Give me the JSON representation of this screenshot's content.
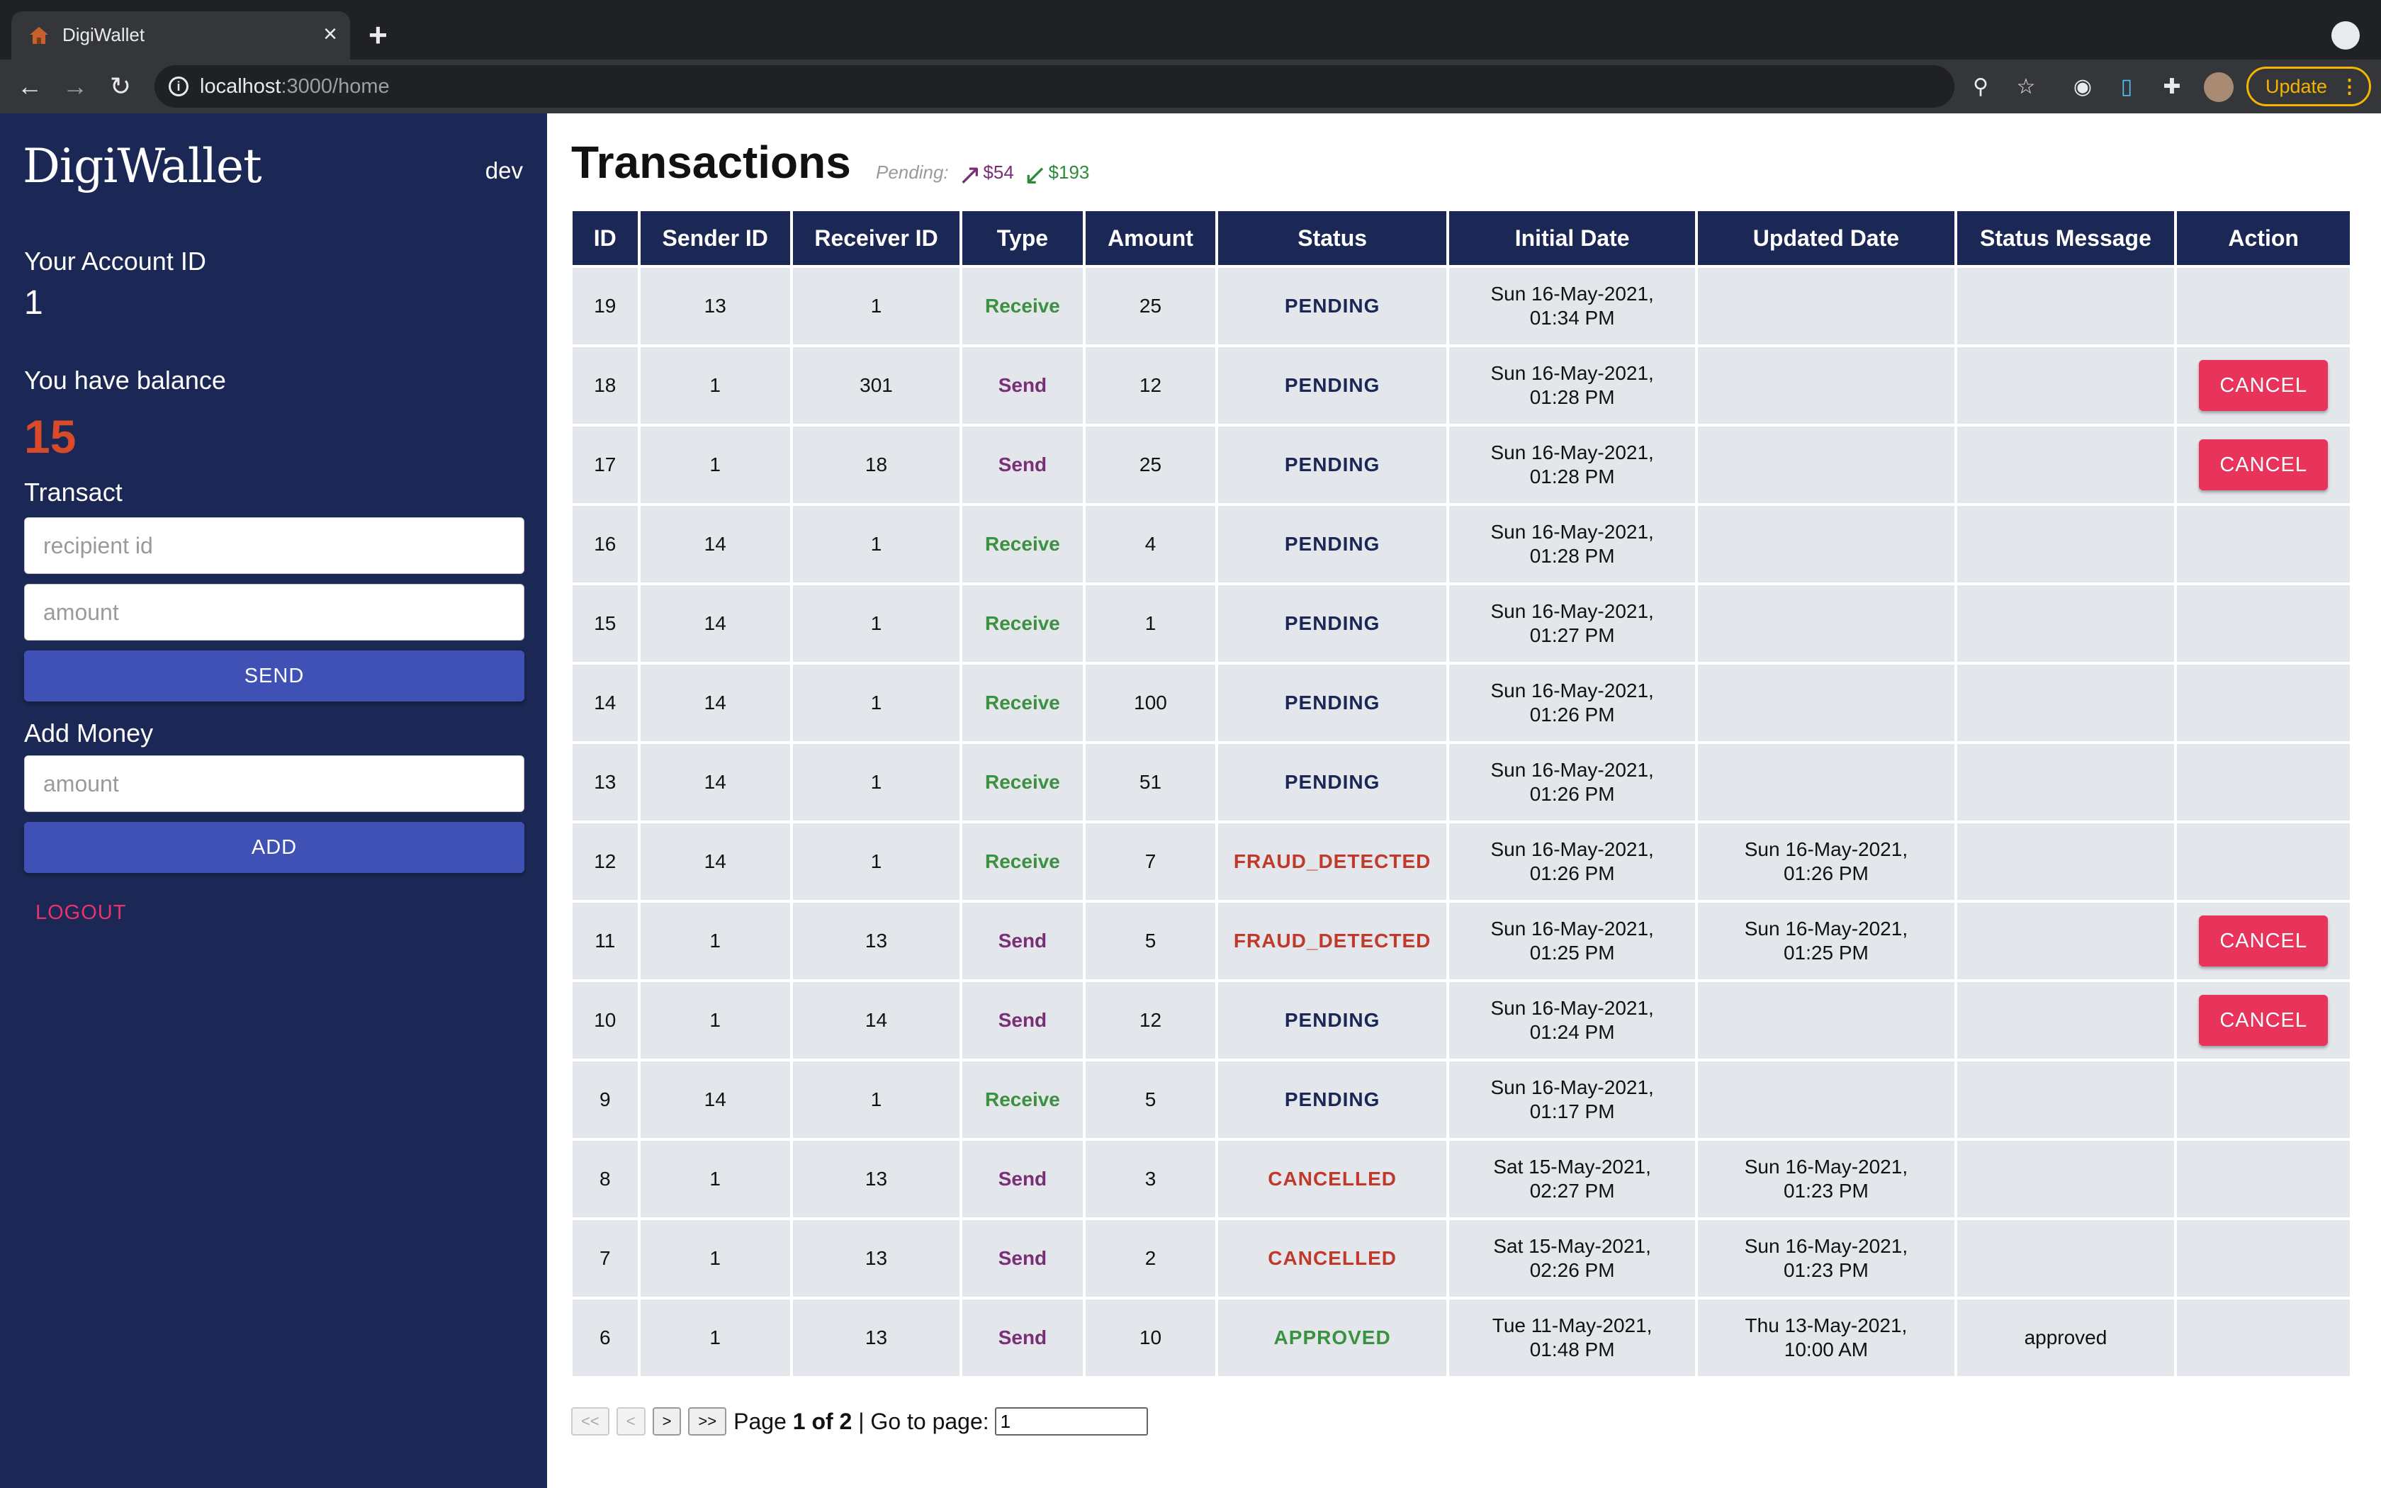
{
  "browser": {
    "tab_title": "DigiWallet",
    "url_host": "localhost",
    "url_path": ":3000/home",
    "update_label": "Update"
  },
  "sidebar": {
    "logo": "DigiWallet",
    "username": "dev",
    "account_label": "Your Account ID",
    "account_id": "1",
    "balance_label": "You have balance",
    "balance": "15",
    "transact_label": "Transact",
    "recipient_placeholder": "recipient id",
    "amount_placeholder": "amount",
    "send_label": "SEND",
    "add_money_label": "Add Money",
    "add_amount_placeholder": "amount",
    "add_label": "ADD",
    "logout_label": "LOGOUT"
  },
  "main": {
    "title": "Transactions",
    "pending_label": "Pending:",
    "pending_out": "$54",
    "pending_in": "$193",
    "columns": [
      "ID",
      "Sender ID",
      "Receiver ID",
      "Type",
      "Amount",
      "Status",
      "Initial Date",
      "Updated Date",
      "Status Message",
      "Action"
    ],
    "rows": [
      {
        "id": "19",
        "sender": "13",
        "receiver": "1",
        "type": "Receive",
        "amount": "25",
        "status": "PENDING",
        "initial_date": "Sun 16-May-2021, 01:34 PM",
        "updated_date": "",
        "message": "",
        "action": ""
      },
      {
        "id": "18",
        "sender": "1",
        "receiver": "301",
        "type": "Send",
        "amount": "12",
        "status": "PENDING",
        "initial_date": "Sun 16-May-2021, 01:28 PM",
        "updated_date": "",
        "message": "",
        "action": "CANCEL"
      },
      {
        "id": "17",
        "sender": "1",
        "receiver": "18",
        "type": "Send",
        "amount": "25",
        "status": "PENDING",
        "initial_date": "Sun 16-May-2021, 01:28 PM",
        "updated_date": "",
        "message": "",
        "action": "CANCEL"
      },
      {
        "id": "16",
        "sender": "14",
        "receiver": "1",
        "type": "Receive",
        "amount": "4",
        "status": "PENDING",
        "initial_date": "Sun 16-May-2021, 01:28 PM",
        "updated_date": "",
        "message": "",
        "action": ""
      },
      {
        "id": "15",
        "sender": "14",
        "receiver": "1",
        "type": "Receive",
        "amount": "1",
        "status": "PENDING",
        "initial_date": "Sun 16-May-2021, 01:27 PM",
        "updated_date": "",
        "message": "",
        "action": ""
      },
      {
        "id": "14",
        "sender": "14",
        "receiver": "1",
        "type": "Receive",
        "amount": "100",
        "status": "PENDING",
        "initial_date": "Sun 16-May-2021, 01:26 PM",
        "updated_date": "",
        "message": "",
        "action": ""
      },
      {
        "id": "13",
        "sender": "14",
        "receiver": "1",
        "type": "Receive",
        "amount": "51",
        "status": "PENDING",
        "initial_date": "Sun 16-May-2021, 01:26 PM",
        "updated_date": "",
        "message": "",
        "action": ""
      },
      {
        "id": "12",
        "sender": "14",
        "receiver": "1",
        "type": "Receive",
        "amount": "7",
        "status": "FRAUD_DETECTED",
        "initial_date": "Sun 16-May-2021, 01:26 PM",
        "updated_date": "Sun 16-May-2021, 01:26 PM",
        "message": "",
        "action": ""
      },
      {
        "id": "11",
        "sender": "1",
        "receiver": "13",
        "type": "Send",
        "amount": "5",
        "status": "FRAUD_DETECTED",
        "initial_date": "Sun 16-May-2021, 01:25 PM",
        "updated_date": "Sun 16-May-2021, 01:25 PM",
        "message": "",
        "action": "CANCEL"
      },
      {
        "id": "10",
        "sender": "1",
        "receiver": "14",
        "type": "Send",
        "amount": "12",
        "status": "PENDING",
        "initial_date": "Sun 16-May-2021, 01:24 PM",
        "updated_date": "",
        "message": "",
        "action": "CANCEL"
      },
      {
        "id": "9",
        "sender": "14",
        "receiver": "1",
        "type": "Receive",
        "amount": "5",
        "status": "PENDING",
        "initial_date": "Sun 16-May-2021, 01:17 PM",
        "updated_date": "",
        "message": "",
        "action": ""
      },
      {
        "id": "8",
        "sender": "1",
        "receiver": "13",
        "type": "Send",
        "amount": "3",
        "status": "CANCELLED",
        "initial_date": "Sat 15-May-2021, 02:27 PM",
        "updated_date": "Sun 16-May-2021, 01:23 PM",
        "message": "",
        "action": ""
      },
      {
        "id": "7",
        "sender": "1",
        "receiver": "13",
        "type": "Send",
        "amount": "2",
        "status": "CANCELLED",
        "initial_date": "Sat 15-May-2021, 02:26 PM",
        "updated_date": "Sun 16-May-2021, 01:23 PM",
        "message": "",
        "action": ""
      },
      {
        "id": "6",
        "sender": "1",
        "receiver": "13",
        "type": "Send",
        "amount": "10",
        "status": "APPROVED",
        "initial_date": "Tue 11-May-2021, 01:48 PM",
        "updated_date": "Thu 13-May-2021, 10:00 AM",
        "message": "approved",
        "action": ""
      }
    ],
    "pager": {
      "first": "<<",
      "prev": "<",
      "next": ">",
      "last": ">>",
      "page_prefix": "Page",
      "page_of": "1 of 2",
      "goto_label": "| Go to page:",
      "goto_value": "1"
    }
  },
  "colors": {
    "sidebar_bg": "#1b2754",
    "accent_blue": "#3f51b5",
    "cancel_red": "#e8335a",
    "receive_green": "#3a9140",
    "send_purple": "#7a2f74",
    "balance_red": "#d84a2a"
  },
  "icons": [
    "home-favicon-icon",
    "close-icon",
    "plus-icon",
    "back-icon",
    "forward-icon",
    "reload-icon",
    "info-icon",
    "location-icon",
    "star-icon",
    "extension-icon",
    "puzzle-icon",
    "arrow-up-right-icon",
    "arrow-down-left-icon"
  ]
}
